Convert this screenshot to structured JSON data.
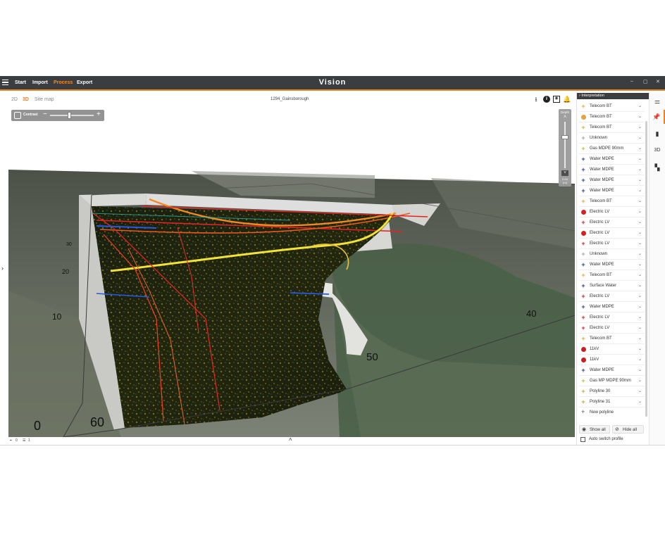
{
  "menu": {
    "items": [
      "Start",
      "Import",
      "Process",
      "Export"
    ],
    "active": "Process",
    "app_title": "Vision"
  },
  "window_controls": [
    "–",
    "▢",
    "✕"
  ],
  "viewer": {
    "tabs": [
      "2D",
      "3D",
      "Site map"
    ],
    "active_tab": "3D",
    "file_name": "1294_Gainsborough",
    "contrast_label": "Contrast",
    "depth_label": "Depth",
    "depth_value": "0.00",
    "depth_unit": "[m]",
    "axis_labels": [
      "60",
      "50",
      "40",
      "30",
      "20",
      "10",
      "0",
      "60",
      "50",
      "40"
    ],
    "status_left_a": "0",
    "status_left_b": "1"
  },
  "interpretation": {
    "title": "Interpretation",
    "items": [
      {
        "label": "Telecom BT",
        "icon": "cross",
        "color": "#e8a23a"
      },
      {
        "label": "Telecom BT",
        "icon": "dot",
        "color": "#e8a23a"
      },
      {
        "label": "Telecom BT",
        "icon": "cross",
        "color": "#e8a23a"
      },
      {
        "label": "Unknown",
        "icon": "cross",
        "color": "#9aa4b0"
      },
      {
        "label": "Gas MDPE 90mm",
        "icon": "cross",
        "color": "#b8c23a"
      },
      {
        "label": "Water MDPE",
        "icon": "cross",
        "color": "#2b3fa0"
      },
      {
        "label": "Water MDPE",
        "icon": "cross",
        "color": "#2b3fa0"
      },
      {
        "label": "Water MDPE",
        "icon": "cross",
        "color": "#2b3fa0"
      },
      {
        "label": "Water MDPE",
        "icon": "cross",
        "color": "#2b3fa0"
      },
      {
        "label": "Telecom BT",
        "icon": "cross",
        "color": "#e8a23a"
      },
      {
        "label": "Electric LV",
        "icon": "dot",
        "color": "#d42020"
      },
      {
        "label": "Electric LV",
        "icon": "cross",
        "color": "#d42020"
      },
      {
        "label": "Electric LV",
        "icon": "dot",
        "color": "#d42020"
      },
      {
        "label": "Electric LV",
        "icon": "cross",
        "color": "#d42020"
      },
      {
        "label": "Unknown",
        "icon": "cross",
        "color": "#9aa4b0"
      },
      {
        "label": "Water MDPE",
        "icon": "cross",
        "color": "#2b3fa0"
      },
      {
        "label": "Telecom BT",
        "icon": "cross",
        "color": "#e8a23a"
      },
      {
        "label": "Surface Water",
        "icon": "cross",
        "color": "#2b3fa0"
      },
      {
        "label": "Electric LV",
        "icon": "cross",
        "color": "#d42020"
      },
      {
        "label": "Water MDPE",
        "icon": "cross",
        "color": "#2b3fa0"
      },
      {
        "label": "Electric LV",
        "icon": "cross",
        "color": "#d42020"
      },
      {
        "label": "Electric LV",
        "icon": "cross",
        "color": "#d42020"
      },
      {
        "label": "Telecom BT",
        "icon": "cross",
        "color": "#e8a23a"
      },
      {
        "label": "11kV",
        "icon": "dot",
        "color": "#c81e1e"
      },
      {
        "label": "11kV",
        "icon": "dot",
        "color": "#c81e1e"
      },
      {
        "label": "Water MDPE",
        "icon": "cross",
        "color": "#2b3fa0"
      },
      {
        "label": "Gas MP MDPE 90mm",
        "icon": "cross",
        "color": "#b8c23a"
      },
      {
        "label": "Polyline 30",
        "icon": "cross",
        "color": "#c8a23a"
      },
      {
        "label": "Polyline 31",
        "icon": "cross",
        "color": "#c8a23a"
      }
    ],
    "new_polyline": "New polyline",
    "show_all": "Show all",
    "hide_all": "Hide all",
    "auto_switch": "Auto switch profile"
  },
  "right_toolbar": [
    "sliders-icon",
    "pin-icon",
    "chart-icon",
    "3D",
    "map-icon"
  ],
  "colors": {
    "accent": "#e8822b",
    "titlebar": "#3b3d40"
  }
}
